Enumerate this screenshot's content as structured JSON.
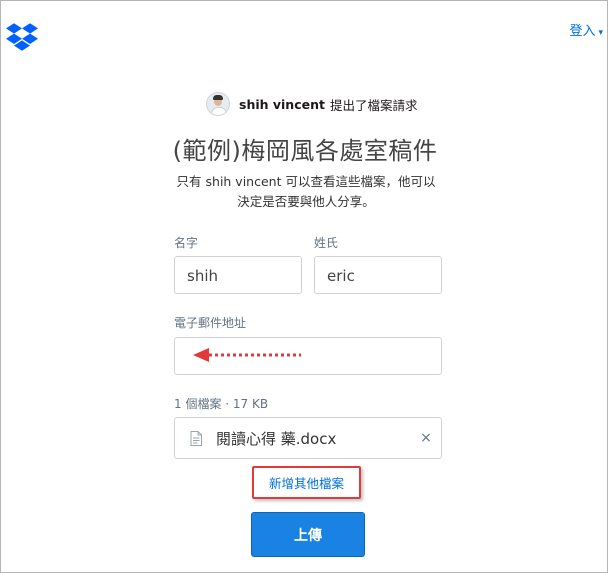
{
  "header": {
    "login_label": "登入",
    "login_caret": "▾"
  },
  "request": {
    "requester_name": "shih vincent",
    "requester_action": "提出了檔案請求",
    "title": "(範例)梅岡風各處室稿件",
    "privacy_line1": "只有 shih vincent 可以查看這些檔案，他可以",
    "privacy_line2": "決定是否要與他人分享。"
  },
  "form": {
    "first_name_label": "名字",
    "first_name_value": "shih",
    "last_name_label": "姓氏",
    "last_name_value": "eric",
    "email_label": "電子郵件地址",
    "email_value": ""
  },
  "files": {
    "summary": "1 個檔案 · 17 KB",
    "items": [
      {
        "name": "閱讀心得 藥.docx"
      }
    ],
    "remove_symbol": "×",
    "add_more_label": "新增其他檔案"
  },
  "actions": {
    "upload_label": "上傳"
  },
  "colors": {
    "accent": "#0070e0",
    "button": "#1a82e2",
    "annotation_red": "#e23a3a"
  }
}
